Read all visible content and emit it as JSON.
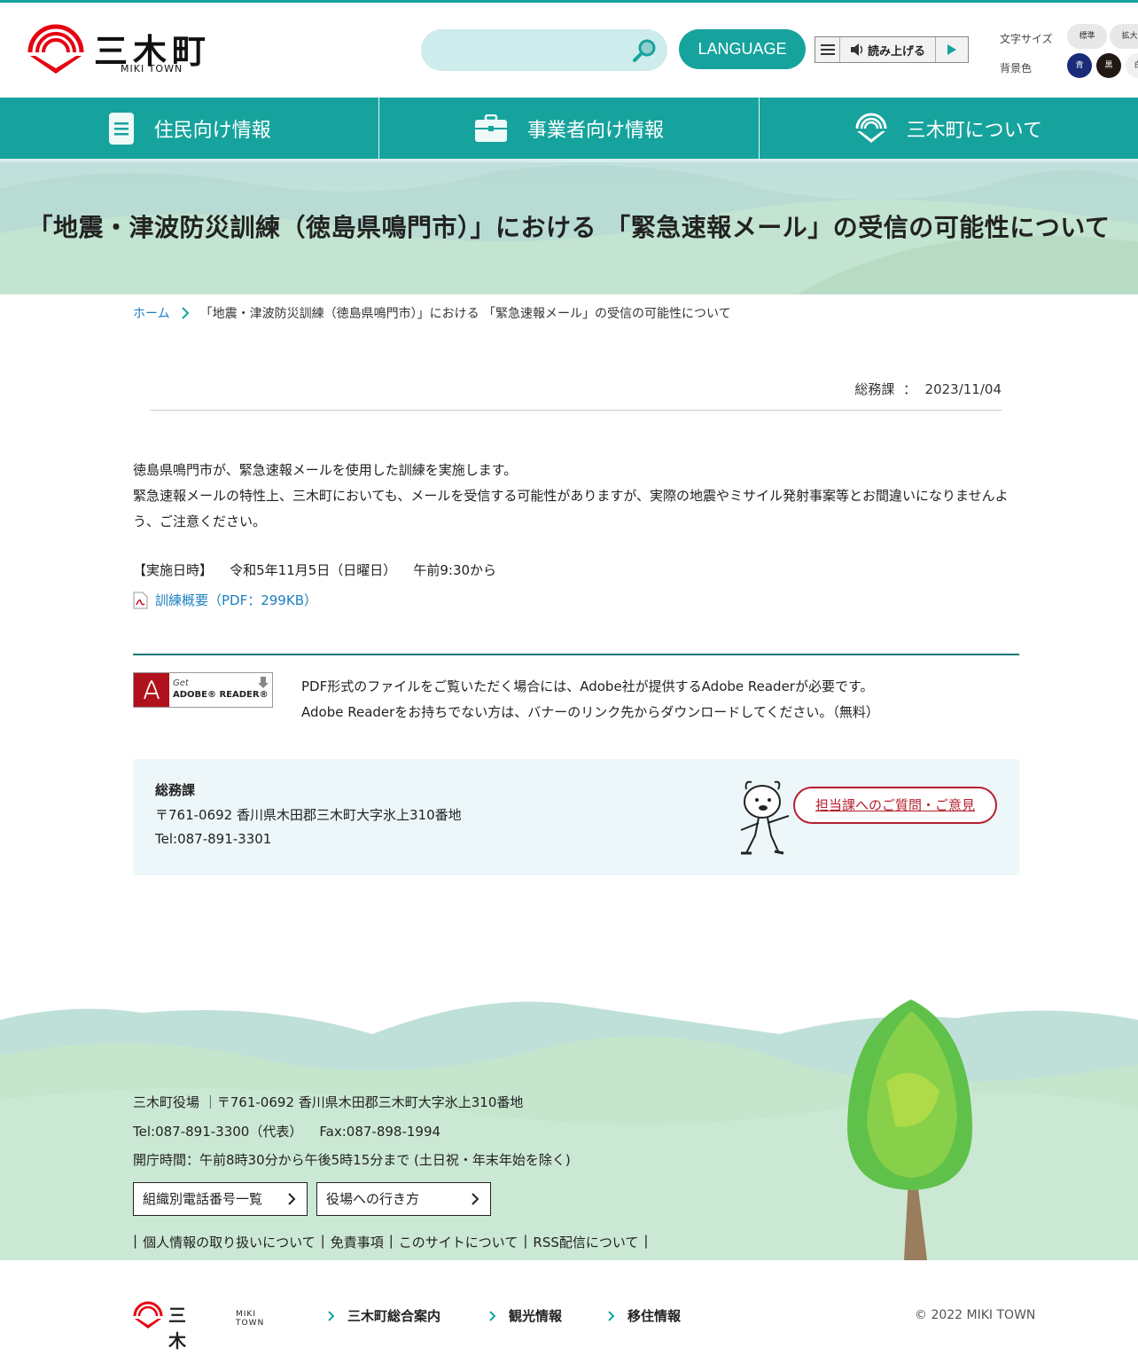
{
  "header": {
    "logo_text": "三木町",
    "logo_sub": "MIKI TOWN",
    "search_placeholder": "",
    "language_label": "LANGUAGE",
    "read_label": "読み上げる",
    "font_size_label": "文字サイズ",
    "font_sizes": [
      "標準",
      "拡大"
    ],
    "bg_color_label": "背景色",
    "bg_colors": [
      {
        "label": "青",
        "color": "#1b2b7a"
      },
      {
        "label": "黒",
        "color": "#221814"
      },
      {
        "label": "白",
        "color": "#f0f0f0"
      }
    ]
  },
  "nav": {
    "items": [
      {
        "label": "住民向け情報",
        "icon": "document-icon"
      },
      {
        "label": "事業者向け情報",
        "icon": "briefcase-icon"
      },
      {
        "label": "三木町について",
        "icon": "town-emblem-icon"
      }
    ]
  },
  "page": {
    "title": "「地震・津波防災訓練（徳島県鳴門市）」における 「緊急速報メール」の受信の可能性について",
    "breadcrumb_home": "ホーム",
    "breadcrumb_current": "「地震・津波防災訓練（徳島県鳴門市）」における 「緊急速報メール」の受信の可能性について",
    "department": "総務課",
    "date": "2023/11/04",
    "body_lines": [
      "徳島県鳴門市が、緊急速報メールを使用した訓練を実施します。",
      "緊急速報メールの特性上、三木町においても、メールを受信する可能性がありますが、実際の地震やミサイル発射事案等とお間違いになりませんよう、ご注意ください。"
    ],
    "date_label": "【実施日時】",
    "date_value": "令和5年11月5日（日曜日）",
    "time_value": "午前9:30から",
    "pdf_link": "訓練概要（PDF：299KB）"
  },
  "adobe": {
    "get": "Get",
    "name": "ADOBE® READER®",
    "text_1": "PDF形式のファイルをご覧いただく場合には、Adobe社が提供するAdobe Readerが必要です。",
    "text_2": "Adobe Readerをお持ちでない方は、バナーのリンク先からダウンロードしてください。（無料）"
  },
  "contact": {
    "title": "総務課",
    "address": "〒761-0692 香川県木田郡三木町大字氷上310番地",
    "tel": "Tel:087-891-3301",
    "button": "担当課へのご質問・ご意見"
  },
  "footer": {
    "address": "三木町役場 ｜〒761-0692 香川県木田郡三木町大字氷上310番地",
    "tel": "Tel:087-891-3300（代表）",
    "fax": "Fax:087-898-1994",
    "hours": "開庁時間：午前8時30分から午後5時15分まで (土日祝・年末年始を除く)",
    "buttons": [
      "組織別電話番号一覧",
      "役場への行き方"
    ],
    "links": [
      "個人情報の取り扱いについて",
      "免責事項",
      "このサイトについて",
      "RSS配信について"
    ],
    "bottom_links": [
      "三木町総合案内",
      "観光情報",
      "移住情報"
    ],
    "copyright": "© 2022 MIKI TOWN"
  },
  "colors": {
    "accent": "#17a39d",
    "link": "#1d7fc1",
    "contact_red": "#b5202e"
  }
}
